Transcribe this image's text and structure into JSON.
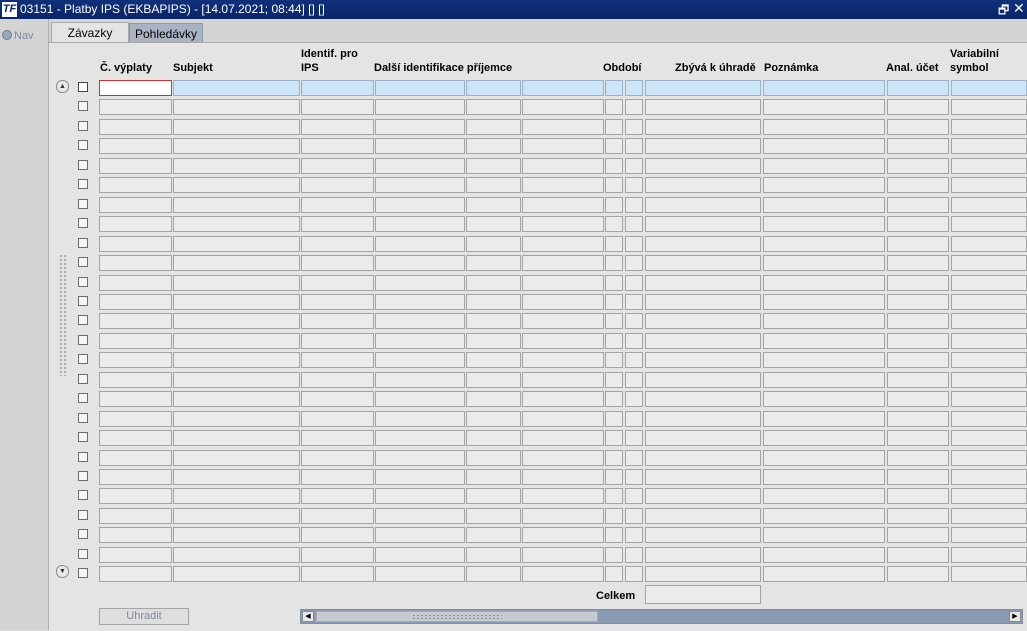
{
  "window": {
    "logo_text": "TF",
    "title": "03151 - Platby IPS (EKBAPIPS) - [14.07.2021; 08:44] [] []",
    "restore_glyph": "🗗",
    "close_glyph": "✕"
  },
  "nav": {
    "label": "Nav"
  },
  "tabs": [
    {
      "label": "Závazky",
      "active": true
    },
    {
      "label": "Pohledávky",
      "active": false
    }
  ],
  "columns": {
    "c_vyplaty": "Č. výplaty",
    "subjekt": "Subjekt",
    "identif_line1": "Identif. pro",
    "identif_line2": "IPS",
    "dalsi": "Další identifikace příjemce",
    "obdobi": "Období",
    "zbyva": "Zbývá k úhradě",
    "poznamka": "Poznámka",
    "anal": "Anal. účet",
    "variabilni_line1": "Variabilní",
    "variabilni_line2": "symbol"
  },
  "grid": {
    "row_count": 26
  },
  "footer": {
    "celkem_label": "Celkem",
    "celkem_value": "",
    "uhradit_label": "Uhradit"
  },
  "icons": {
    "scroll_up": "▲",
    "scroll_down": "▼",
    "scroll_left": "◀",
    "scroll_right": "▶"
  },
  "colors": {
    "titlebar": "#0a246a",
    "selected_row": "#cde3f7",
    "focus_border": "#d03030",
    "inactive_tab": "#a9b3c2"
  }
}
